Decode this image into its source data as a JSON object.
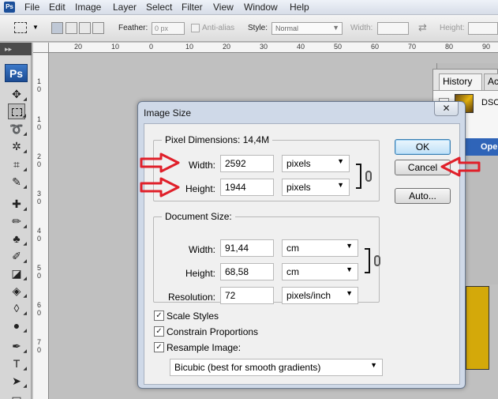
{
  "menubar": {
    "logo": "Ps",
    "items": [
      "File",
      "Edit",
      "Image",
      "Layer",
      "Select",
      "Filter",
      "View",
      "Window",
      "Help"
    ]
  },
  "options_bar": {
    "feather_label": "Feather:",
    "feather_value": "0 px",
    "antialias_label": "Anti-alias",
    "style_label": "Style:",
    "style_value": "Normal",
    "width_label": "Width:",
    "height_label": "Height:"
  },
  "toolbar": {
    "grip": "▸▸",
    "logo": "Ps"
  },
  "ruler": {
    "top_labels": [
      "20",
      "10",
      "0",
      "10",
      "20",
      "30",
      "40",
      "50",
      "60",
      "70",
      "80",
      "90"
    ],
    "left_labels": [
      "1",
      "0",
      "1",
      "0",
      "2",
      "0",
      "3",
      "0",
      "4",
      "0",
      "5",
      "0",
      "6",
      "0",
      "7",
      "0"
    ]
  },
  "history_panel": {
    "tab_history": "History",
    "tab_other": "Ac",
    "item_label": "DSC",
    "selected_item": "Ope"
  },
  "dialog": {
    "title": "Image Size",
    "close": "✕",
    "pixel_dimensions": {
      "title": "Pixel Dimensions:",
      "size": "14,4M",
      "width_label": "Width:",
      "width_value": "2592",
      "width_unit": "pixels",
      "height_label": "Height:",
      "height_value": "1944",
      "height_unit": "pixels"
    },
    "document_size": {
      "title": "Document Size:",
      "width_label": "Width:",
      "width_value": "91,44",
      "width_unit": "cm",
      "height_label": "Height:",
      "height_value": "68,58",
      "height_unit": "cm",
      "resolution_label": "Resolution:",
      "resolution_value": "72",
      "resolution_unit": "pixels/inch"
    },
    "buttons": {
      "ok": "OK",
      "cancel": "Cancel",
      "auto": "Auto..."
    },
    "options": {
      "scale_styles": "Scale Styles",
      "constrain_proportions": "Constrain Proportions",
      "resample_image": "Resample Image:",
      "resample_method": "Bicubic (best for smooth gradients)"
    },
    "checked": {
      "scale_styles": true,
      "constrain_proportions": true,
      "resample_image": true
    }
  },
  "colors": {
    "annotation_arrow": "#e0202a",
    "dialog_frame": "#cfd9e8",
    "canvas_bg": "#c0c0c0",
    "image_yellow": "#d4a90a"
  }
}
